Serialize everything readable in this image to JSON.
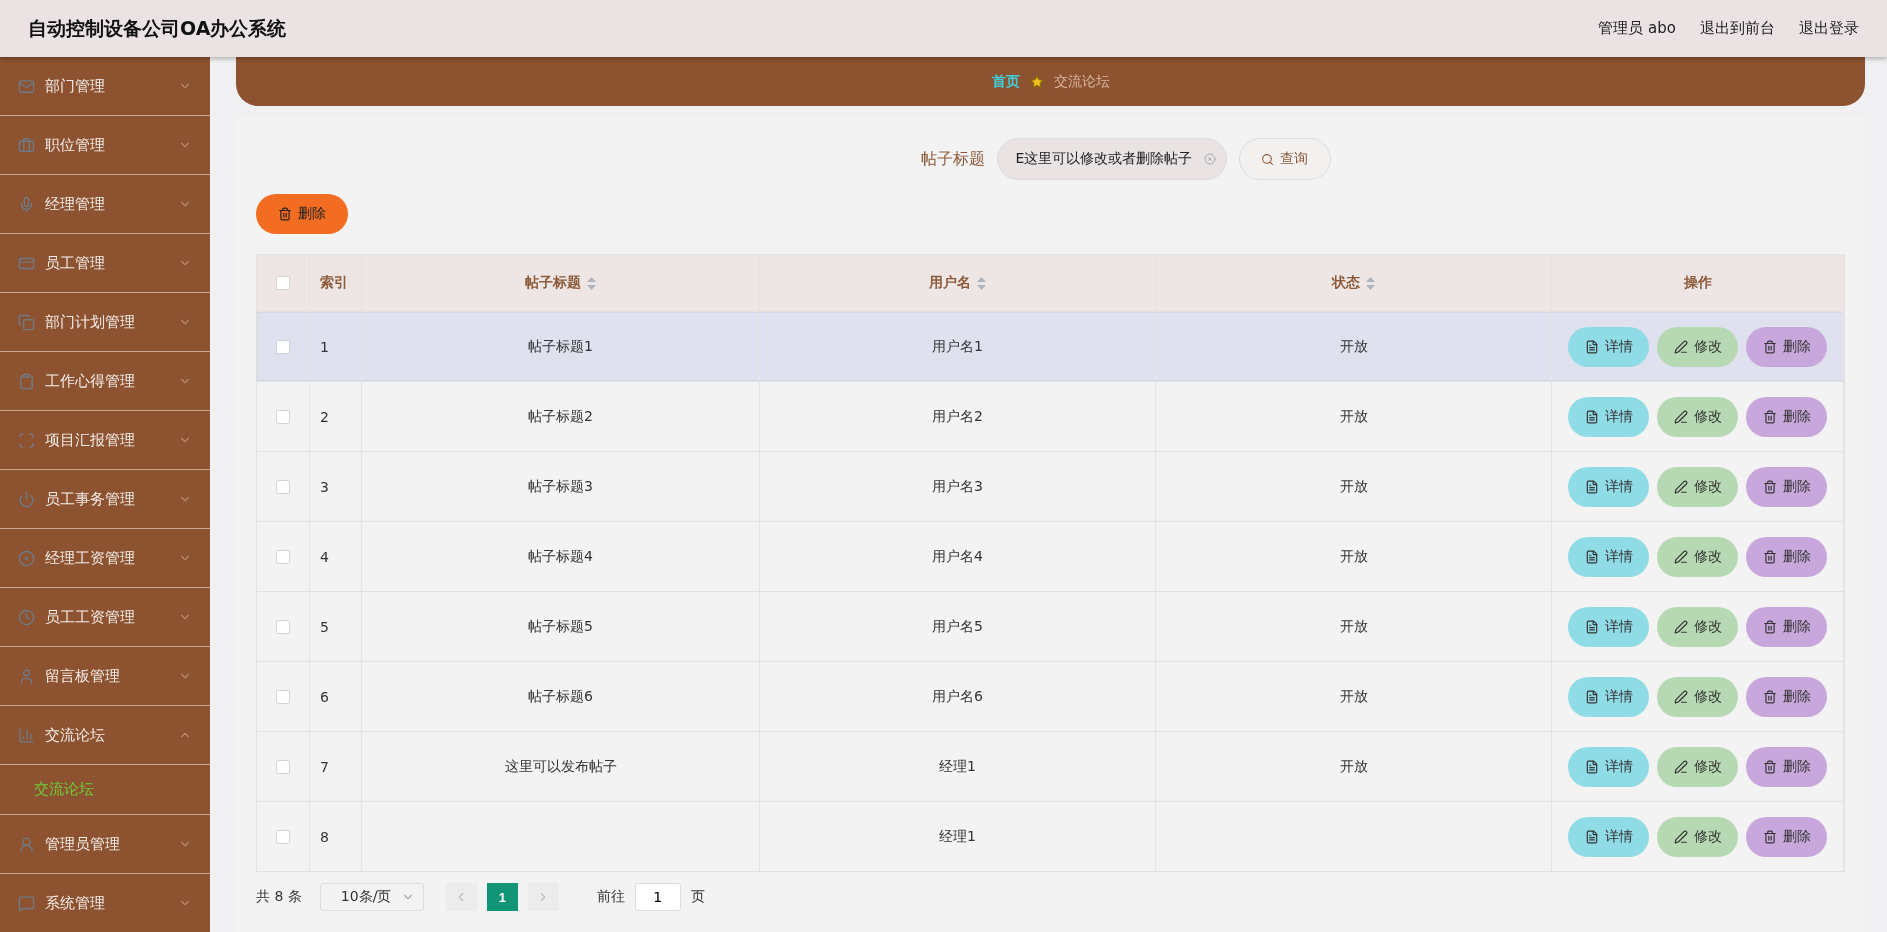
{
  "header": {
    "title": "自动控制设备公司OA办公系统",
    "user": "管理员 abo",
    "links": [
      "退出到前台",
      "退出登录"
    ]
  },
  "sidebar": {
    "items": [
      {
        "label": "部门管理",
        "expanded": false
      },
      {
        "label": "职位管理",
        "expanded": false
      },
      {
        "label": "经理管理",
        "expanded": false
      },
      {
        "label": "员工管理",
        "expanded": false
      },
      {
        "label": "部门计划管理",
        "expanded": false
      },
      {
        "label": "工作心得管理",
        "expanded": false
      },
      {
        "label": "项目汇报管理",
        "expanded": false
      },
      {
        "label": "员工事务管理",
        "expanded": false
      },
      {
        "label": "经理工资管理",
        "expanded": false
      },
      {
        "label": "员工工资管理",
        "expanded": false
      },
      {
        "label": "留言板管理",
        "expanded": false
      },
      {
        "label": "交流论坛",
        "expanded": true,
        "children": [
          {
            "label": "交流论坛",
            "selected": true
          }
        ]
      },
      {
        "label": "管理员管理",
        "expanded": false
      },
      {
        "label": "系统管理",
        "expanded": false
      }
    ]
  },
  "breadcrumb": [
    "首页",
    "交流论坛"
  ],
  "search": {
    "label": "帖子标题",
    "value": "E这里可以修改或者删除帖子",
    "button": "查询"
  },
  "delete_button": "删除",
  "table": {
    "columns": [
      {
        "label": "索引",
        "sortable": false
      },
      {
        "label": "帖子标题",
        "sortable": true
      },
      {
        "label": "用户名",
        "sortable": true
      },
      {
        "label": "状态",
        "sortable": true
      },
      {
        "label": "操作",
        "sortable": false
      }
    ],
    "select_all": false,
    "rows": [
      {
        "index": "1",
        "title": "帖子标题1",
        "user": "用户名1",
        "status": "开放",
        "selected": false,
        "highlighted": true,
        "actions": [
          "详情",
          "修改",
          "删除"
        ]
      },
      {
        "index": "2",
        "title": "帖子标题2",
        "user": "用户名2",
        "status": "开放",
        "selected": false,
        "highlighted": false,
        "actions": [
          "详情",
          "修改",
          "删除"
        ]
      },
      {
        "index": "3",
        "title": "帖子标题3",
        "user": "用户名3",
        "status": "开放",
        "selected": false,
        "highlighted": false,
        "actions": [
          "详情",
          "修改",
          "删除"
        ]
      },
      {
        "index": "4",
        "title": "帖子标题4",
        "user": "用户名4",
        "status": "开放",
        "selected": false,
        "highlighted": false,
        "actions": [
          "详情",
          "修改",
          "删除"
        ]
      },
      {
        "index": "5",
        "title": "帖子标题5",
        "user": "用户名5",
        "status": "开放",
        "selected": false,
        "highlighted": false,
        "actions": [
          "详情",
          "修改",
          "删除"
        ]
      },
      {
        "index": "6",
        "title": "帖子标题6",
        "user": "用户名6",
        "status": "开放",
        "selected": false,
        "highlighted": false,
        "actions": [
          "详情",
          "修改",
          "删除"
        ]
      },
      {
        "index": "7",
        "title": "这里可以发布帖子",
        "user": "经理1",
        "status": "开放",
        "selected": false,
        "highlighted": false,
        "actions": [
          "详情",
          "修改",
          "删除"
        ]
      },
      {
        "index": "8",
        "user": "经理1",
        "selected": false,
        "highlighted": false,
        "actions": [
          "详情",
          "修改",
          "删除"
        ]
      }
    ]
  },
  "pagination": {
    "total": "共 8 条",
    "page_size": "10条/页",
    "pages": [
      {
        "label": "1",
        "selected": true
      }
    ],
    "goto_label": "前往",
    "goto_value": "1",
    "goto_suffix": "页"
  }
}
